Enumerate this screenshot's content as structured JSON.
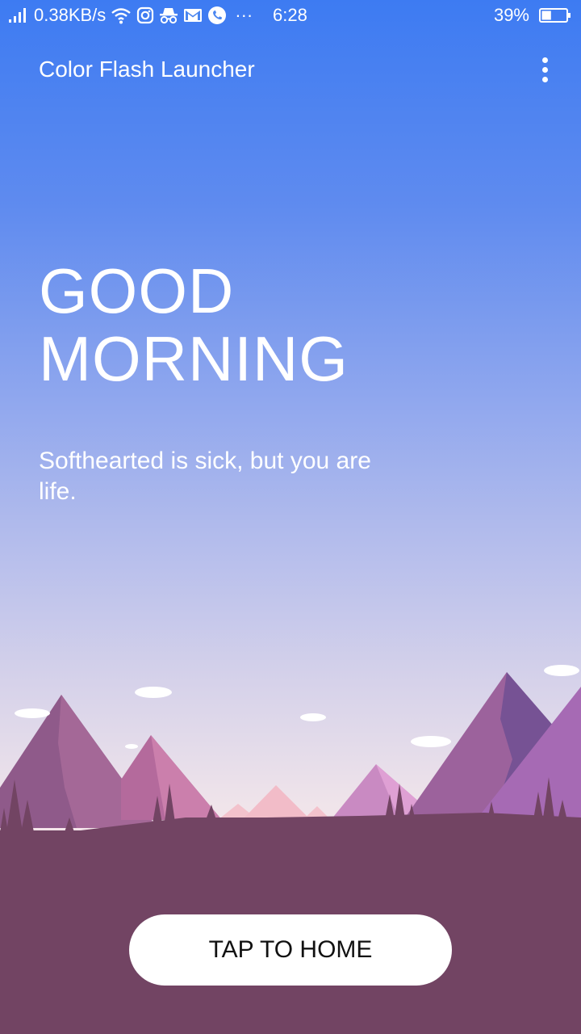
{
  "status_bar": {
    "network_speed": "0.38KB/s",
    "time": "6:28",
    "battery": "39%",
    "battery_level": 0.39,
    "overflow": "···",
    "icons": [
      "signal-icon",
      "wifi-icon",
      "instagram-icon",
      "incognito-icon",
      "gmail-icon",
      "whatsapp-icon",
      "battery-icon"
    ]
  },
  "app_bar": {
    "title": "Color Flash Launcher",
    "menu_icon": "more-vert-icon"
  },
  "main": {
    "greeting_line1": "GOOD",
    "greeting_line2": "MORNING",
    "quote": "Softhearted is sick, but you are life."
  },
  "footer": {
    "button_label": "TAP TO HOME"
  },
  "colors": {
    "sky_top": "#3d7bf2",
    "sky_bottom": "#fde8ea",
    "ground": "#724463",
    "mountain_dark": "#8f5a8a",
    "mountain_light": "#c87aa8",
    "button_bg": "#ffffff"
  }
}
